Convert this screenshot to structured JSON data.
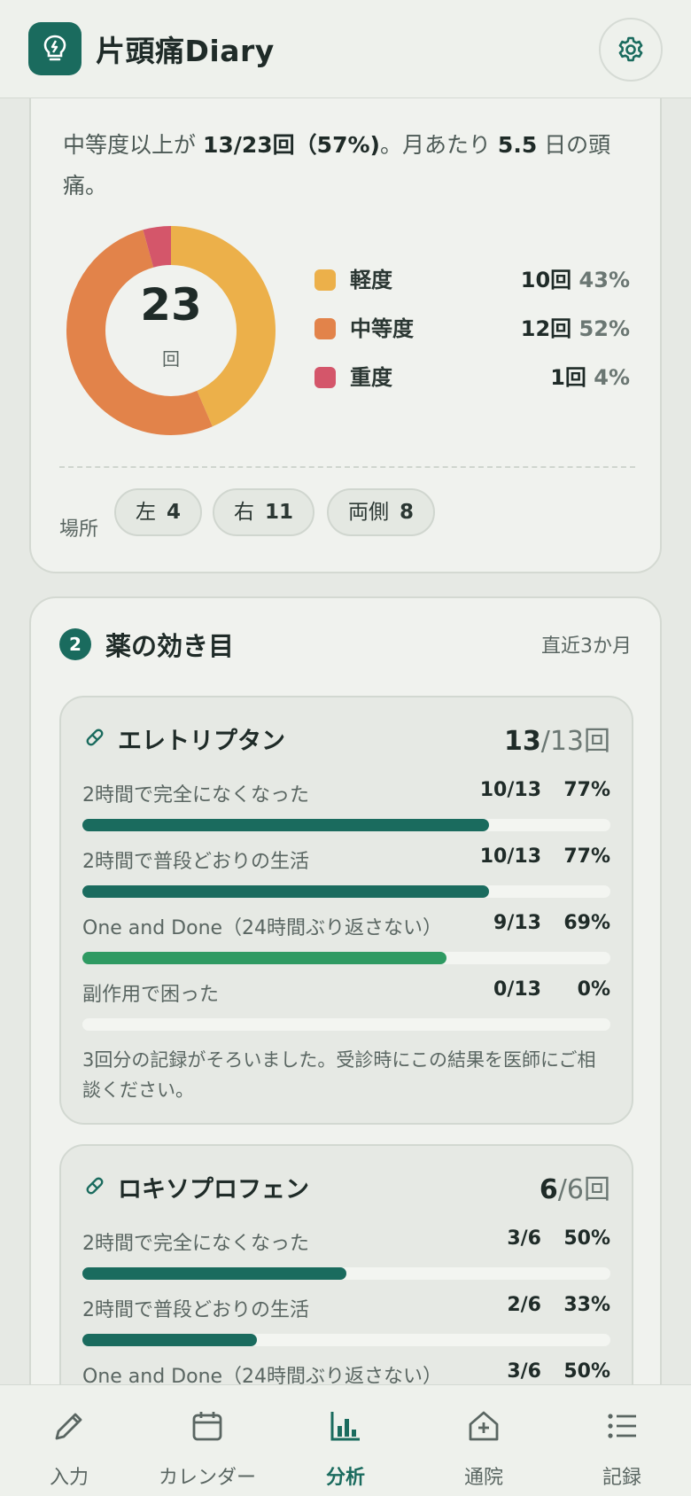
{
  "header": {
    "title": "片頭痛Diary"
  },
  "severity": {
    "summary": {
      "prefix": "中等度以上が",
      "ratio": "13/23回（57%)",
      "mid": "。月あたり",
      "days": "5.5",
      "suffix": "日の頭痛。"
    },
    "total": "23",
    "total_unit": "回",
    "legend": [
      {
        "label": "軽度",
        "count": "10回",
        "pct": "43%",
        "color": "#ecb04a"
      },
      {
        "label": "中等度",
        "count": "12回",
        "pct": "52%",
        "color": "#e2834a"
      },
      {
        "label": "重度",
        "count": "1回",
        "pct": "4%",
        "color": "#d4566a"
      }
    ],
    "location_label": "場所",
    "locations": [
      {
        "label": "左",
        "count": "4"
      },
      {
        "label": "右",
        "count": "11"
      },
      {
        "label": "両側",
        "count": "8"
      }
    ]
  },
  "efficacy": {
    "number": "2",
    "title": "薬の効き目",
    "period": "直近3か月",
    "meds": [
      {
        "name": "エレトリプタン",
        "used": "13",
        "total": "/13回",
        "rows": [
          {
            "label": "2時間で完全になくなった",
            "frac": "10/13",
            "pct": "77%",
            "value": 0.77
          },
          {
            "label": "2時間で普段どおりの生活",
            "frac": "10/13",
            "pct": "77%",
            "value": 0.77
          },
          {
            "label": "One and Done（24時間ぶり返さない）",
            "frac": "9/13",
            "pct": "69%",
            "value": 0.69
          },
          {
            "label": "副作用で困った",
            "frac": "0/13",
            "pct": "0%",
            "value": 0
          }
        ],
        "note": "3回分の記録がそろいました。受診時にこの結果を医師にご相談ください。"
      },
      {
        "name": "ロキソプロフェン",
        "used": "6",
        "total": "/6回",
        "rows": [
          {
            "label": "2時間で完全になくなった",
            "frac": "3/6",
            "pct": "50%",
            "value": 0.5
          },
          {
            "label": "2時間で普段どおりの生活",
            "frac": "2/6",
            "pct": "33%",
            "value": 0.33
          },
          {
            "label": "One and Done（24時間ぶり返さない）",
            "frac": "3/6",
            "pct": "50%",
            "value": 0.5
          }
        ]
      }
    ]
  },
  "nav": [
    {
      "label": "入力",
      "icon": "pencil-icon"
    },
    {
      "label": "カレンダー",
      "icon": "calendar-icon"
    },
    {
      "label": "分析",
      "icon": "bar-chart-icon",
      "active": true
    },
    {
      "label": "通院",
      "icon": "clinic-icon"
    },
    {
      "label": "記録",
      "icon": "list-icon"
    }
  ]
}
